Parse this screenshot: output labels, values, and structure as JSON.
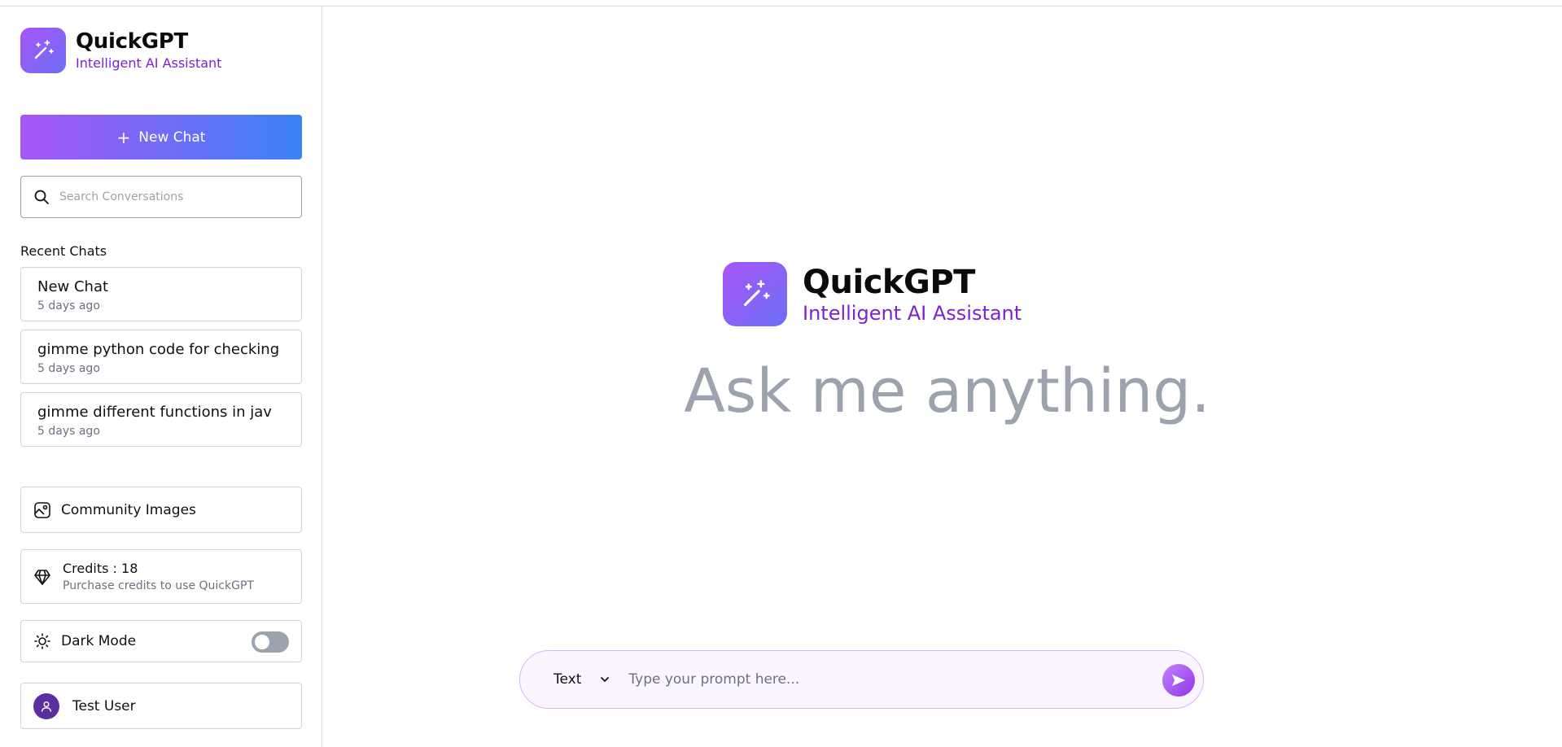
{
  "app": {
    "title": "QuickGPT",
    "subtitle": "Intelligent AI Assistant"
  },
  "sidebar": {
    "new_chat_label": "New Chat",
    "search_placeholder": "Search Conversations",
    "recent_label": "Recent Chats",
    "chats": [
      {
        "title": "New Chat",
        "time": "5 days ago"
      },
      {
        "title": "gimme python code for checking g",
        "time": "5 days ago"
      },
      {
        "title": "gimme different functions in jav",
        "time": "5 days ago"
      }
    ],
    "community_label": "Community Images",
    "credits_label": "Credits : 18",
    "credits_sub": "Purchase credits to use QuickGPT",
    "dark_mode_label": "Dark Mode",
    "dark_mode_on": false,
    "user_name": "Test User"
  },
  "main": {
    "title": "QuickGPT",
    "subtitle": "Intelligent AI Assistant",
    "headline": "Ask me anything."
  },
  "prompt": {
    "mode": "Text",
    "placeholder": "Type your prompt here..."
  },
  "colors": {
    "accent_purple": "#a855f7",
    "accent_blue": "#3b82f6",
    "subtitle_purple": "#7e22ce"
  }
}
